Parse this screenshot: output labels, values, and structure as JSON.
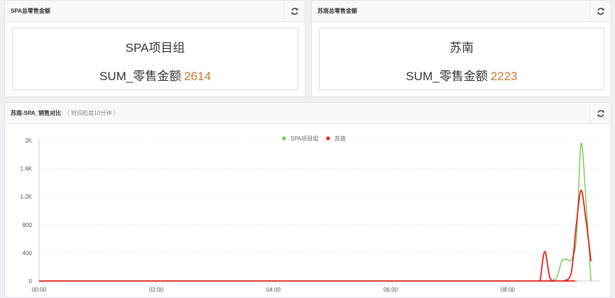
{
  "panels": {
    "spa": {
      "title": "SPA总零售金额",
      "name": "SPA项目组",
      "metric_label": "SUM_零售金额",
      "value": "2614"
    },
    "sunan": {
      "title": "苏南总零售金额",
      "name": "苏南",
      "metric_label": "SUM_零售金额",
      "value": "2223"
    },
    "compare": {
      "title": "苏南-SPA_销售对比",
      "subtitle": "（ 时间粒度10分钟 ）"
    }
  },
  "icons": {
    "refresh": "refresh-icon"
  },
  "colors": {
    "accent_value": "#c8792d",
    "series_spa": "#6cc644",
    "series_sunan": "#e8201c"
  },
  "chart_data": {
    "type": "line",
    "title": "",
    "xlabel": "",
    "ylabel": "",
    "x_ticks": [
      "00:00",
      "02:00",
      "04:00",
      "06:00",
      "08:00"
    ],
    "x_range_hours": [
      0,
      9.5
    ],
    "ylim": [
      0,
      2000
    ],
    "y_ticks": [
      0,
      400,
      800,
      1200,
      1600,
      2000
    ],
    "y_tick_labels": [
      "0",
      "400",
      "800",
      "1.2K",
      "1.6K",
      "2K"
    ],
    "grid": true,
    "legend": "top-center",
    "series": [
      {
        "name": "SPA项目组",
        "color": "#6cc644",
        "points": [
          [
            0,
            0
          ],
          [
            8.5,
            0
          ],
          [
            8.67,
            0
          ],
          [
            8.83,
            40
          ],
          [
            8.92,
            280
          ],
          [
            9.0,
            310
          ],
          [
            9.08,
            300
          ],
          [
            9.17,
            600
          ],
          [
            9.25,
            1950
          ],
          [
            9.33,
            1200
          ],
          [
            9.42,
            0
          ]
        ]
      },
      {
        "name": "苏南",
        "color": "#e8201c",
        "points": [
          [
            0,
            0
          ],
          [
            8.5,
            0
          ],
          [
            8.55,
            0
          ],
          [
            8.63,
            420
          ],
          [
            8.72,
            40
          ],
          [
            8.8,
            0
          ],
          [
            8.95,
            0
          ],
          [
            9.08,
            100
          ],
          [
            9.17,
            800
          ],
          [
            9.25,
            1290
          ],
          [
            9.33,
            900
          ],
          [
            9.42,
            280
          ]
        ]
      }
    ]
  }
}
